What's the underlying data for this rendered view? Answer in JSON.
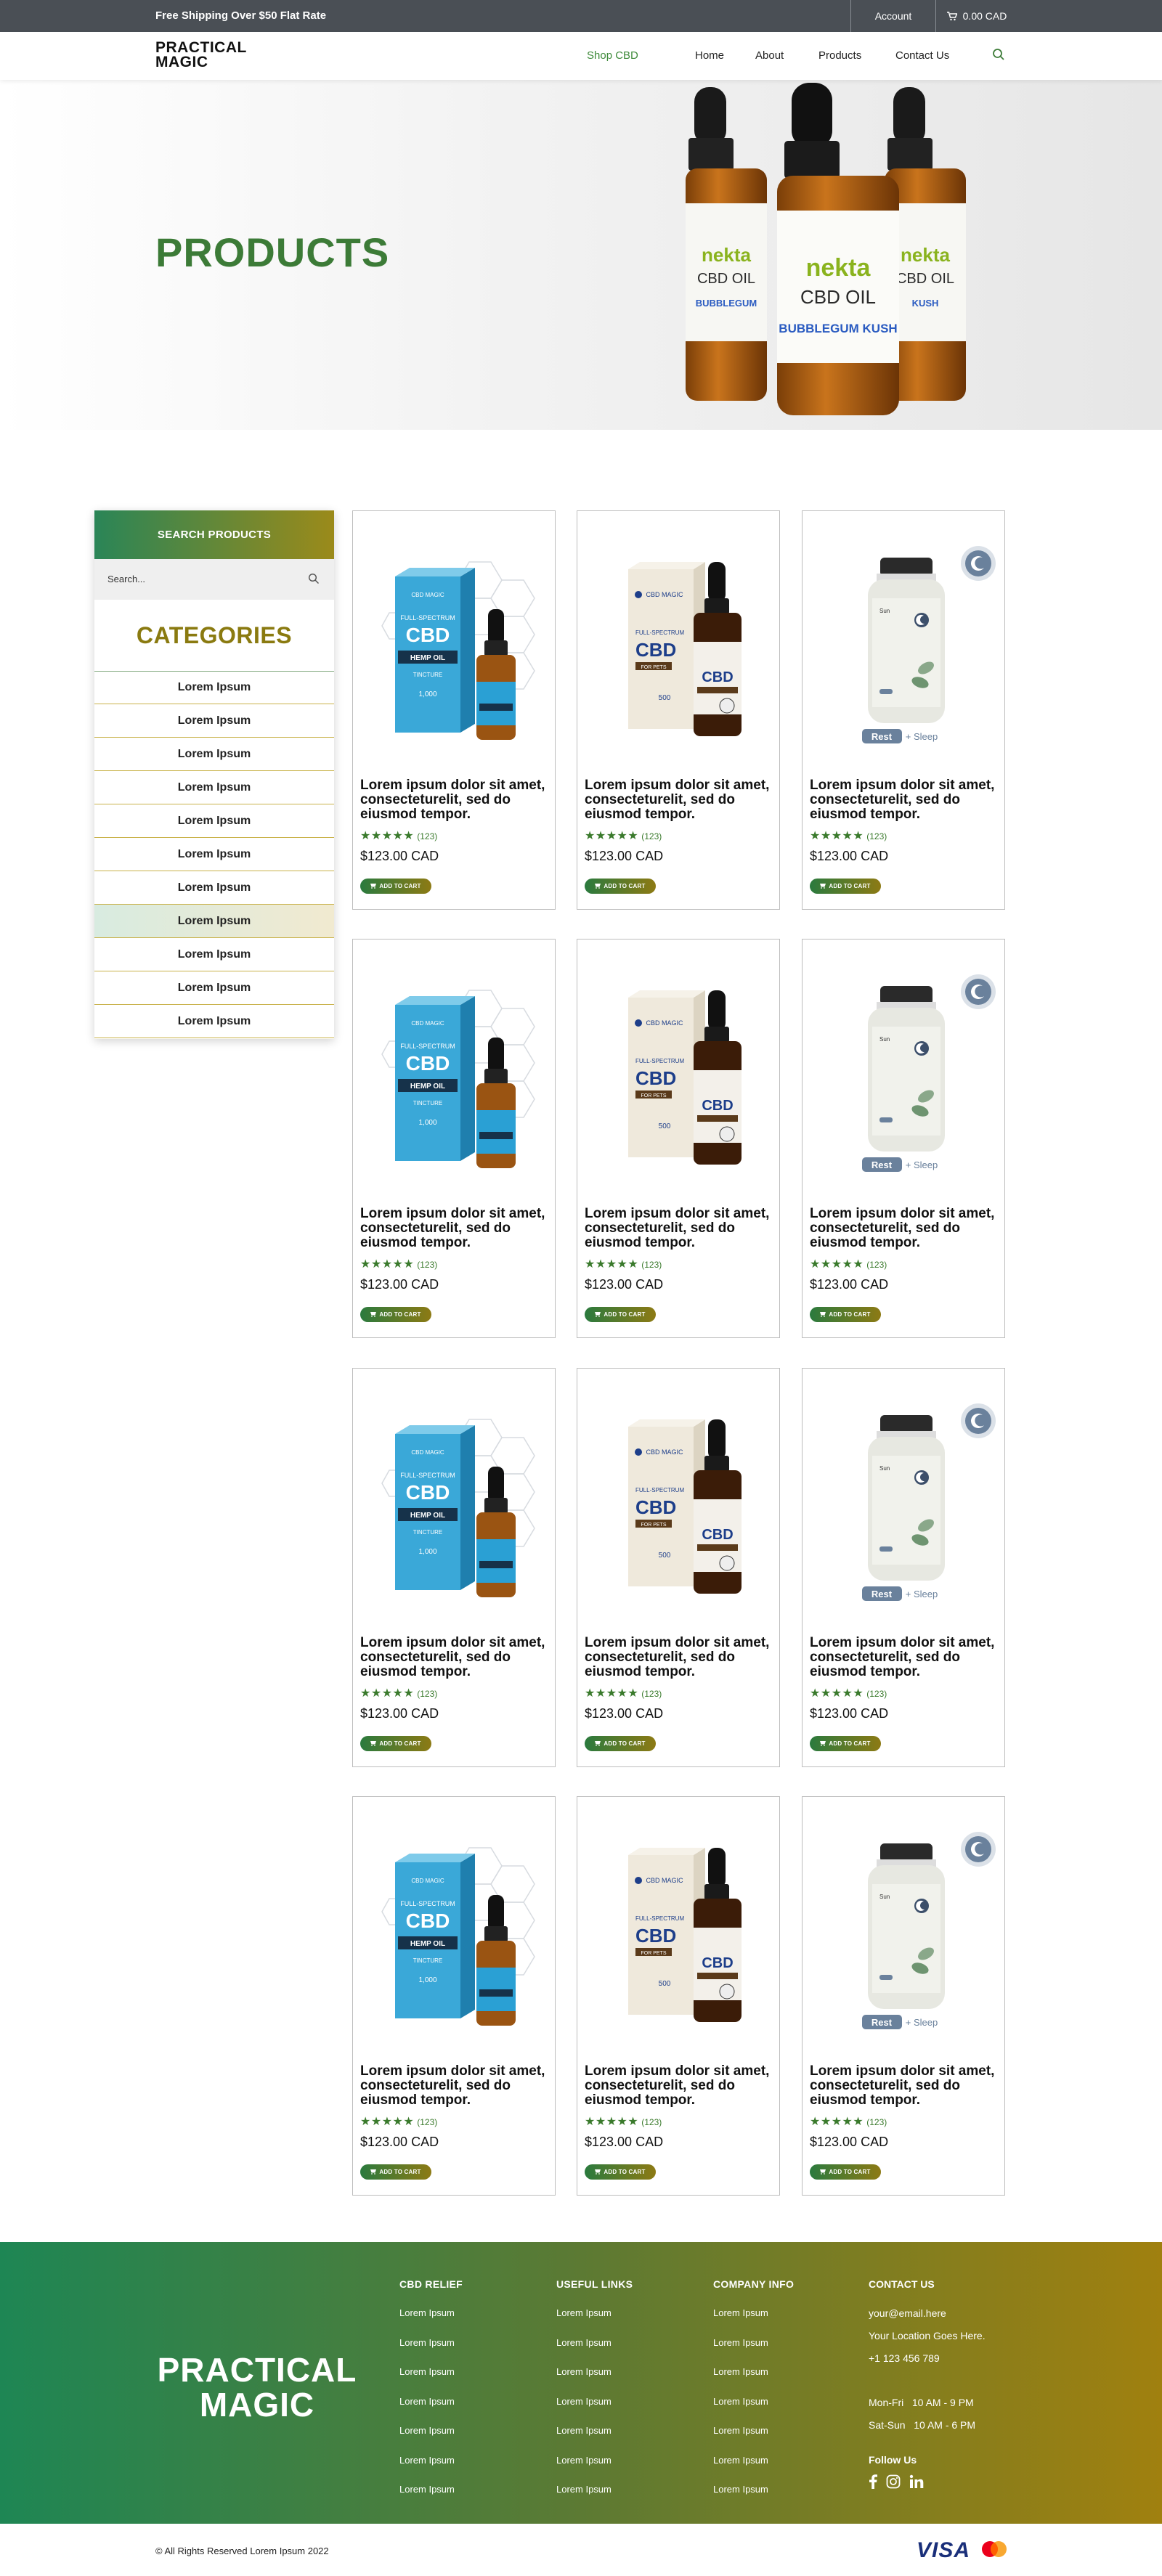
{
  "topbar": {
    "shipping": "Free Shipping Over $50 Flat Rate",
    "account": "Account",
    "cart_total": "0.00 CAD"
  },
  "header": {
    "logo_line1": "PRACTICAL",
    "logo_line2": "MAGIC",
    "nav": [
      "Shop CBD",
      "Home",
      "About",
      "Products",
      "Contact Us"
    ]
  },
  "hero": {
    "title": "PRODUCTS",
    "bottle_brand": "nekta",
    "bottle_product": "CBD OIL",
    "bottle_flavor": "BUBBLEGUM KUSH"
  },
  "sidebar": {
    "search_heading": "SEARCH PRODUCTS",
    "search_placeholder": "Search...",
    "categories_title": "CATEGORIES",
    "categories": [
      "Lorem Ipsum",
      "Lorem Ipsum",
      "Lorem Ipsum",
      "Lorem Ipsum",
      "Lorem Ipsum",
      "Lorem Ipsum",
      "Lorem Ipsum",
      "Lorem Ipsum",
      "Lorem Ipsum",
      "Lorem Ipsum",
      "Lorem Ipsum"
    ]
  },
  "product": {
    "title": "Lorem ipsum dolor sit amet, consecteturelit, sed do eiusmod tempor.",
    "stars": "★★★★★",
    "rating_count": "(123)",
    "price": "$123.00 CAD",
    "add_to_cart": "ADD TO CART",
    "box_brand": "CBD MAGIC",
    "box_line": "FULL-SPECTRUM",
    "box_cbd": "CBD",
    "box_hemp": "HEMP OIL",
    "box_tincture": "TINCTURE",
    "box_mg": "1,000",
    "pet_for": "FOR PETS",
    "pet_mg": "500",
    "gummy_rest": "Rest",
    "gummy_sleep": "+ Sleep"
  },
  "footer": {
    "logo_line1": "PRACTICAL",
    "logo_line2": "MAGIC",
    "columns": [
      {
        "title": "CBD RELIEF",
        "links": [
          "Lorem Ipsum",
          "Lorem Ipsum",
          "Lorem Ipsum",
          "Lorem Ipsum",
          "Lorem Ipsum",
          "Lorem Ipsum",
          "Lorem Ipsum"
        ]
      },
      {
        "title": "USEFUL LINKS",
        "links": [
          "Lorem Ipsum",
          "Lorem Ipsum",
          "Lorem Ipsum",
          "Lorem Ipsum",
          "Lorem Ipsum",
          "Lorem Ipsum",
          "Lorem Ipsum"
        ]
      },
      {
        "title": "COMPANY INFO",
        "links": [
          "Lorem Ipsum",
          "Lorem Ipsum",
          "Lorem Ipsum",
          "Lorem Ipsum",
          "Lorem Ipsum",
          "Lorem Ipsum",
          "Lorem Ipsum"
        ]
      }
    ],
    "contact_title": "CONTACT US",
    "email": "your@email.here",
    "location": "Your Location Goes Here.",
    "phone": "+1 123 456 789",
    "hours1": "Mon-Fri   10 AM - 9 PM",
    "hours2": "Sat-Sun   10 AM - 6 PM",
    "follow": "Follow Us",
    "social_icons": [
      "facebook-icon",
      "instagram-icon",
      "linkedin-icon"
    ]
  },
  "bottom": {
    "copyright": "© All Rights Reserved Lorem Ipsum 2022",
    "visa": "VISA"
  },
  "colors": {
    "green": "#3c7b37",
    "gold": "#8a7a10",
    "topbar": "#4a4f55"
  }
}
